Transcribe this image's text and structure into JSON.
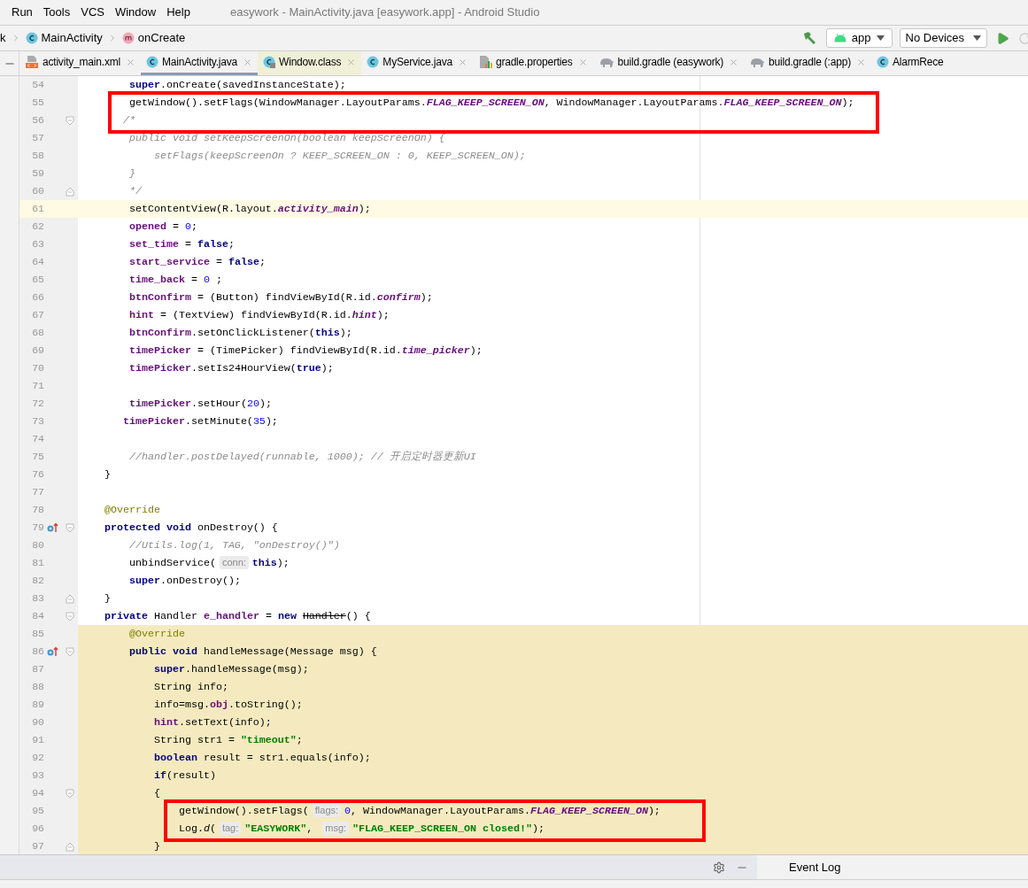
{
  "menu": [
    "Run",
    "Tools",
    "VCS",
    "Window",
    "Help"
  ],
  "window": {
    "title": "easywork - MainActivity.java [easywork.app] - Android Studio"
  },
  "breadcrumbs": [
    {
      "label": "k",
      "kind": "plain"
    },
    {
      "label": "MainActivity",
      "kind": "class"
    },
    {
      "label": "onCreate",
      "kind": "method"
    }
  ],
  "toolbar": {
    "configuration": "app",
    "device": "No Devices"
  },
  "tabs": [
    {
      "label": "activity_main.xml",
      "kind": "xml",
      "selected": false,
      "closable": true
    },
    {
      "label": "MainActivity.java",
      "kind": "class",
      "selected": true,
      "closable": true
    },
    {
      "label": "Window.class",
      "kind": "library",
      "selected": false,
      "closable": true
    },
    {
      "label": "MyService.java",
      "kind": "class",
      "selected": false,
      "closable": true
    },
    {
      "label": "gradle.properties",
      "kind": "properties",
      "selected": false,
      "closable": true
    },
    {
      "label": "build.gradle (easywork)",
      "kind": "gradle",
      "selected": false,
      "closable": true
    },
    {
      "label": "build.gradle (:app)",
      "kind": "gradle",
      "selected": false,
      "closable": true
    },
    {
      "label": "AlarmRece",
      "kind": "class",
      "selected": false,
      "closable": false
    }
  ],
  "editor": {
    "lines": [
      {
        "n": "54",
        "current": false,
        "marked": false,
        "boxed": false,
        "code": [
          {
            "text": "        super",
            "kind": "keyword"
          },
          {
            "text": ".onCreate(savedInstanceState);",
            "kind": "plain"
          }
        ]
      },
      {
        "n": "55",
        "current": false,
        "marked": false,
        "boxed": true,
        "code": [
          {
            "text": "        getWindow().setFlags(WindowManager.LayoutParams.",
            "kind": "plain"
          },
          {
            "text": "FLAG_KEEP_SCREEN_ON",
            "kind": "constant"
          },
          {
            "text": ", WindowManager.LayoutParams.",
            "kind": "plain"
          },
          {
            "text": "FLAG_KEEP_SCREEN_ON",
            "kind": "constant"
          },
          {
            "text": ");",
            "kind": "plain"
          }
        ]
      },
      {
        "n": "56",
        "current": false,
        "marked": false,
        "boxed": true,
        "fold_start": true,
        "code": [
          {
            "text": "       /*",
            "kind": "comment"
          }
        ]
      },
      {
        "n": "57",
        "current": false,
        "marked": false,
        "boxed": false,
        "code": [
          {
            "text": "        public void setKeepScreenOn(boolean keepScreenOn) {",
            "kind": "comment"
          }
        ]
      },
      {
        "n": "58",
        "current": false,
        "marked": false,
        "boxed": false,
        "code": [
          {
            "text": "            setFlags(keepScreenOn ? KEEP_SCREEN_ON : 0, KEEP_SCREEN_ON);",
            "kind": "comment"
          }
        ]
      },
      {
        "n": "59",
        "current": false,
        "marked": false,
        "boxed": false,
        "code": [
          {
            "text": "        }",
            "kind": "comment"
          }
        ]
      },
      {
        "n": "60",
        "current": false,
        "marked": false,
        "boxed": false,
        "fold_end": true,
        "code": [
          {
            "text": "        */",
            "kind": "comment"
          }
        ]
      },
      {
        "n": "61",
        "current": true,
        "marked": false,
        "boxed": false,
        "code": [
          {
            "text": "        setContentView(R.layout.",
            "kind": "plain"
          },
          {
            "text": "activity_main",
            "kind": "constant"
          },
          {
            "text": ");",
            "kind": "plain"
          }
        ]
      },
      {
        "n": "62",
        "current": false,
        "marked": false,
        "boxed": false,
        "code": [
          {
            "text": "        opened",
            "kind": "field"
          },
          {
            "text": " = ",
            "kind": "plain"
          },
          {
            "text": "0",
            "kind": "number"
          },
          {
            "text": ";",
            "kind": "plain"
          }
        ]
      },
      {
        "n": "63",
        "current": false,
        "marked": false,
        "boxed": false,
        "code": [
          {
            "text": "        set_time",
            "kind": "field"
          },
          {
            "text": " = ",
            "kind": "plain"
          },
          {
            "text": "false",
            "kind": "keyword"
          },
          {
            "text": ";",
            "kind": "plain"
          }
        ]
      },
      {
        "n": "64",
        "current": false,
        "marked": false,
        "boxed": false,
        "code": [
          {
            "text": "        start_service",
            "kind": "field"
          },
          {
            "text": " = ",
            "kind": "plain"
          },
          {
            "text": "false",
            "kind": "keyword"
          },
          {
            "text": ";",
            "kind": "plain"
          }
        ]
      },
      {
        "n": "65",
        "current": false,
        "marked": false,
        "boxed": false,
        "code": [
          {
            "text": "        time_back",
            "kind": "field"
          },
          {
            "text": " = ",
            "kind": "plain"
          },
          {
            "text": "0",
            "kind": "number"
          },
          {
            "text": " ;",
            "kind": "plain"
          }
        ]
      },
      {
        "n": "66",
        "current": false,
        "marked": false,
        "boxed": false,
        "code": [
          {
            "text": "        btnConfirm",
            "kind": "field"
          },
          {
            "text": " = (Button) findViewById(R.id.",
            "kind": "plain"
          },
          {
            "text": "confirm",
            "kind": "constant"
          },
          {
            "text": ");",
            "kind": "plain"
          }
        ]
      },
      {
        "n": "67",
        "current": false,
        "marked": false,
        "boxed": false,
        "code": [
          {
            "text": "        hint",
            "kind": "field"
          },
          {
            "text": " = (TextView) findViewById(R.id.",
            "kind": "plain"
          },
          {
            "text": "hint",
            "kind": "constant"
          },
          {
            "text": ");",
            "kind": "plain"
          }
        ]
      },
      {
        "n": "68",
        "current": false,
        "marked": false,
        "boxed": false,
        "code": [
          {
            "text": "        btnConfirm",
            "kind": "field"
          },
          {
            "text": ".setOnClickListener(",
            "kind": "plain"
          },
          {
            "text": "this",
            "kind": "keyword"
          },
          {
            "text": ");",
            "kind": "plain"
          }
        ]
      },
      {
        "n": "69",
        "current": false,
        "marked": false,
        "boxed": false,
        "code": [
          {
            "text": "        timePicker",
            "kind": "field"
          },
          {
            "text": " = (TimePicker) findViewById(R.id.",
            "kind": "plain"
          },
          {
            "text": "time_picker",
            "kind": "constant"
          },
          {
            "text": ");",
            "kind": "plain"
          }
        ]
      },
      {
        "n": "70",
        "current": false,
        "marked": false,
        "boxed": false,
        "code": [
          {
            "text": "        timePicker",
            "kind": "field"
          },
          {
            "text": ".setIs24HourView(",
            "kind": "plain"
          },
          {
            "text": "true",
            "kind": "keyword"
          },
          {
            "text": ");",
            "kind": "plain"
          }
        ]
      },
      {
        "n": "71",
        "current": false,
        "marked": false,
        "boxed": false
      },
      {
        "n": "72",
        "current": false,
        "marked": false,
        "boxed": false,
        "code": [
          {
            "text": "        timePicker",
            "kind": "field"
          },
          {
            "text": ".setHour(",
            "kind": "plain"
          },
          {
            "text": "20",
            "kind": "number"
          },
          {
            "text": ");",
            "kind": "plain"
          }
        ]
      },
      {
        "n": "73",
        "current": false,
        "marked": false,
        "boxed": false,
        "code": [
          {
            "text": "       timePicker",
            "kind": "field"
          },
          {
            "text": ".setMinute(",
            "kind": "plain"
          },
          {
            "text": "35",
            "kind": "number"
          },
          {
            "text": ");",
            "kind": "plain"
          }
        ]
      },
      {
        "n": "74",
        "current": false,
        "marked": false,
        "boxed": false
      },
      {
        "n": "75",
        "current": false,
        "marked": false,
        "boxed": false,
        "code": [
          {
            "text": "        //handler.postDelayed(runnable, 1000); // 开启定时器更新UI",
            "kind": "comment"
          }
        ]
      },
      {
        "n": "76",
        "current": false,
        "marked": false,
        "boxed": false,
        "code": [
          {
            "text": "    }",
            "kind": "plain"
          }
        ]
      },
      {
        "n": "77",
        "current": false,
        "marked": false,
        "boxed": false
      },
      {
        "n": "78",
        "current": false,
        "marked": false,
        "boxed": false,
        "code": [
          {
            "text": "    @Override",
            "kind": "annotation"
          }
        ]
      },
      {
        "n": "79",
        "current": false,
        "marked": false,
        "boxed": false,
        "overrides": true,
        "fold_start": true,
        "code": [
          {
            "text": "    protected void",
            "kind": "keyword"
          },
          {
            "text": " onDestroy() {",
            "kind": "plain"
          }
        ]
      },
      {
        "n": "80",
        "current": false,
        "marked": false,
        "boxed": false,
        "code": [
          {
            "text": "        //Utils.log(1, TAG, \"onDestroy()\")",
            "kind": "comment"
          }
        ]
      },
      {
        "n": "81",
        "current": false,
        "marked": false,
        "boxed": false,
        "code": [
          {
            "text": "        unbindService(",
            "kind": "plain"
          },
          {
            "text": "conn:",
            "kind": "hint"
          },
          {
            "text": "this",
            "kind": "keyword"
          },
          {
            "text": ");",
            "kind": "plain"
          }
        ]
      },
      {
        "n": "82",
        "current": false,
        "marked": false,
        "boxed": false,
        "code": [
          {
            "text": "        super",
            "kind": "keyword"
          },
          {
            "text": ".onDestroy();",
            "kind": "plain"
          }
        ]
      },
      {
        "n": "83",
        "current": false,
        "marked": false,
        "boxed": false,
        "fold_end": true,
        "code": [
          {
            "text": "    }",
            "kind": "plain"
          }
        ]
      },
      {
        "n": "84",
        "current": false,
        "marked": false,
        "boxed": false,
        "fold_start": true,
        "code": [
          {
            "text": "    private",
            "kind": "keyword"
          },
          {
            "text": " Handler ",
            "kind": "plain"
          },
          {
            "text": "e_handler",
            "kind": "field"
          },
          {
            "text": " = ",
            "kind": "plain"
          },
          {
            "text": "new ",
            "kind": "keyword"
          },
          {
            "text": "Handler",
            "kind": "deprecated"
          },
          {
            "text": "() {",
            "kind": "plain"
          }
        ]
      },
      {
        "n": "85",
        "current": false,
        "marked": true,
        "boxed": false,
        "code": [
          {
            "text": "        @Override",
            "kind": "annotation"
          }
        ]
      },
      {
        "n": "86",
        "current": false,
        "marked": true,
        "boxed": false,
        "overrides": true,
        "fold_start": true,
        "code": [
          {
            "text": "        public void",
            "kind": "keyword"
          },
          {
            "text": " handleMessage(Message msg) {",
            "kind": "plain"
          }
        ]
      },
      {
        "n": "87",
        "current": false,
        "marked": true,
        "boxed": false,
        "code": [
          {
            "text": "            super",
            "kind": "keyword"
          },
          {
            "text": ".handleMessage(msg);",
            "kind": "plain"
          }
        ]
      },
      {
        "n": "88",
        "current": false,
        "marked": true,
        "boxed": false,
        "code": [
          {
            "text": "            String info;",
            "kind": "plain"
          }
        ]
      },
      {
        "n": "89",
        "current": false,
        "marked": true,
        "boxed": false,
        "code": [
          {
            "text": "            info=msg.",
            "kind": "plain"
          },
          {
            "text": "obj",
            "kind": "field"
          },
          {
            "text": ".toString();",
            "kind": "plain"
          }
        ]
      },
      {
        "n": "90",
        "current": false,
        "marked": true,
        "boxed": false,
        "code": [
          {
            "text": "            hint",
            "kind": "field"
          },
          {
            "text": ".setText(info);",
            "kind": "plain"
          }
        ]
      },
      {
        "n": "91",
        "current": false,
        "marked": true,
        "boxed": false,
        "code": [
          {
            "text": "            String str1 = ",
            "kind": "plain"
          },
          {
            "text": "\"timeout\"",
            "kind": "string"
          },
          {
            "text": ";",
            "kind": "plain"
          }
        ]
      },
      {
        "n": "92",
        "current": false,
        "marked": true,
        "boxed": false,
        "code": [
          {
            "text": "            boolean",
            "kind": "keyword"
          },
          {
            "text": " result = str1.equals(info);",
            "kind": "plain"
          }
        ]
      },
      {
        "n": "93",
        "current": false,
        "marked": true,
        "boxed": false,
        "code": [
          {
            "text": "            if",
            "kind": "keyword"
          },
          {
            "text": "(result)",
            "kind": "plain"
          }
        ]
      },
      {
        "n": "94",
        "current": false,
        "marked": true,
        "boxed": false,
        "fold_start": true,
        "code": [
          {
            "text": "            {",
            "kind": "plain"
          }
        ]
      },
      {
        "n": "95",
        "current": false,
        "marked": true,
        "boxed": true,
        "code": [
          {
            "text": "                getWindow().setFlags(",
            "kind": "plain"
          },
          {
            "text": "flags:",
            "kind": "hint"
          },
          {
            "text": "0",
            "kind": "number"
          },
          {
            "text": ", WindowManager.LayoutParams.",
            "kind": "plain"
          },
          {
            "text": "FLAG_KEEP_SCREEN_ON",
            "kind": "constant"
          },
          {
            "text": ");",
            "kind": "plain"
          }
        ]
      },
      {
        "n": "96",
        "current": false,
        "marked": true,
        "boxed": true,
        "code": [
          {
            "text": "                Log.",
            "kind": "plain"
          },
          {
            "text": "d",
            "kind": "italic"
          },
          {
            "text": "(",
            "kind": "plain"
          },
          {
            "text": "tag:",
            "kind": "hint"
          },
          {
            "text": "\"EASYWORK\"",
            "kind": "string"
          },
          {
            "text": ", ",
            "kind": "plain"
          },
          {
            "text": "msg:",
            "kind": "hint"
          },
          {
            "text": "\"FLAG_KEEP_SCREEN_ON closed!\"",
            "kind": "string"
          },
          {
            "text": ");",
            "kind": "plain"
          }
        ]
      },
      {
        "n": "97",
        "current": false,
        "marked": true,
        "boxed": false,
        "fold_end": true,
        "code": [
          {
            "text": "            }",
            "kind": "plain"
          }
        ]
      }
    ]
  },
  "bottom_bar": {
    "tab": "Event Log"
  }
}
